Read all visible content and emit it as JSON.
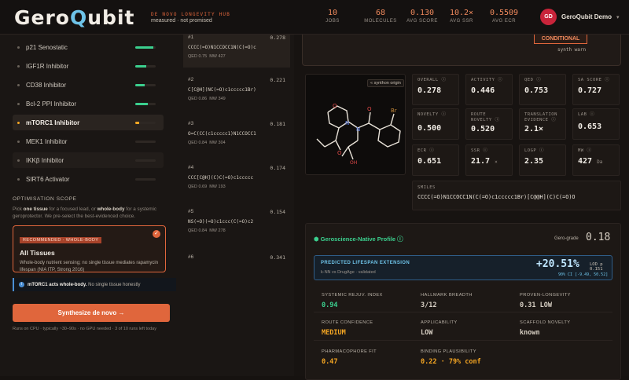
{
  "header": {
    "logo": "GeroQubit",
    "tagline_1": "DE NOVO LONGEVITY HUB",
    "tagline_2": "measured · not promised",
    "stats": [
      {
        "value": "10",
        "label": "JOBS"
      },
      {
        "value": "68",
        "label": "MOLECULES"
      },
      {
        "value": "0.130",
        "label": "AVG SCORE"
      },
      {
        "value": "10.2×",
        "label": "AVG SSR"
      },
      {
        "value": "0.5509",
        "label": "AVG ECR"
      }
    ],
    "user": {
      "initials": "GD",
      "name": "GeroQubit Demo",
      "chevron": "▾"
    }
  },
  "targets": [
    {
      "label": "p21 Senostatic",
      "progress": 0.9
    },
    {
      "label": "IGF1R Inhibitor",
      "progress": 0.55
    },
    {
      "label": "CD38 Inhibitor",
      "progress": 0.45
    },
    {
      "label": "Bcl-2 PPI Inhibitor",
      "progress": 0.6
    },
    {
      "label": "mTORC1 Inhibitor",
      "progress": 0.2
    },
    {
      "label": "MEK1 Inhibitor",
      "progress": 0.0
    },
    {
      "label": "IKKβ Inhibitor",
      "progress": 0.0
    },
    {
      "label": "SIRT6 Activator",
      "progress": 0.0
    }
  ],
  "scope": {
    "title": "OPTIMISATION SCOPE",
    "desc_1": "Pick ",
    "desc_b1": "one tissue",
    "desc_2": " for a focused lead, or ",
    "desc_b2": "whole-body",
    "desc_3": " for a systemic geroprotector. We pre-select the best-evidenced choice.",
    "card_badge": "RECOMMENDED · WHOLE-BODY",
    "card_title": "All Tissues",
    "card_body": "Whole-body nutrient sensing; no single tissue mediates rapamycin lifespan (NIA ITP, Strong 2016)",
    "note_bold": "mTORC1 acts whole-body.",
    "note_text": " No single tissue honestly",
    "button": "Synthesize de novo →",
    "runs": "Runs on CPU · typically ~30–90s · no GPU needed · 3 of 10 runs left today"
  },
  "molecules": [
    {
      "rank": "#1",
      "score": "0.278",
      "smiles": "CCCC(=O)N1CCOCC1N(C(=O)c",
      "qed": "QED 0.75",
      "mw": "MW 427"
    },
    {
      "rank": "#2",
      "score": "0.221",
      "smiles": "C[C@H](NC(=O)c1ccccc1Br)",
      "qed": "QED 0.86",
      "mw": "MW 349"
    },
    {
      "rank": "#3",
      "score": "0.181",
      "smiles": "O=C(CC(c1ccccc1)N1CCOCC1",
      "qed": "QED 0.84",
      "mw": "MW 304"
    },
    {
      "rank": "#4",
      "score": "0.174",
      "smiles": "CCC[C@H](C)C(=O)c1ccccc",
      "qed": "QED 0.69",
      "mw": "MW 193"
    },
    {
      "rank": "#5",
      "score": "0.154",
      "smiles": "NS(=O)(=O)c1ccc(C(=O)c2",
      "qed": "QED 0.84",
      "mw": "MW 278"
    },
    {
      "rank": "#6",
      "score": "0.341",
      "smiles": "",
      "qed": "",
      "mw": ""
    }
  ],
  "detail": {
    "condition": "CONDITIONAL",
    "synth_warn": "synth warn",
    "origin_button": "« synthon origin",
    "metrics": [
      {
        "k": "OVERALL ⓘ",
        "v": "0.278",
        "unit": ""
      },
      {
        "k": "ACTIVITY ⓘ",
        "v": "0.446",
        "unit": ""
      },
      {
        "k": "QED ⓘ",
        "v": "0.753",
        "unit": ""
      },
      {
        "k": "SA SCORE ⓘ",
        "v": "0.727",
        "unit": ""
      },
      {
        "k": "NOVELTY ⓘ",
        "v": "0.500",
        "unit": ""
      },
      {
        "k": "ROUTE NOVELTY ⓘ",
        "v": "0.520",
        "unit": ""
      },
      {
        "k": "TRANSLATION EVIDENCE ⓘ",
        "v": "2.1×",
        "unit": ""
      },
      {
        "k": "LAB ⓘ",
        "v": "0.653",
        "unit": ""
      },
      {
        "k": "ECR ⓘ",
        "v": "0.651",
        "unit": ""
      },
      {
        "k": "SSR ⓘ",
        "v": "21.7",
        "unit": "×"
      },
      {
        "k": "LOGP ⓘ",
        "v": "2.35",
        "unit": ""
      },
      {
        "k": "MW ⓘ",
        "v": "427",
        "unit": "Da"
      }
    ],
    "smiles_label": "SMILES",
    "smiles": "CCCC(=O)N1CCOCC1N(C(=O)c1ccccc1Br)[C@@H](C)C(=O)O"
  },
  "geroscience": {
    "title": "Geroscience-Native Profile ⓘ",
    "grade_label": "Gero-grade",
    "grade_value": "0.18",
    "lifespan_label": "PREDICTED LIFESPAN EXTENSION",
    "lifespan_sub": "k-NN vs DrugAge · validated",
    "lifespan_value": "+20.51%",
    "lod": "LOD p 0.151",
    "ci": "90% CI [-9.49, 50.52]",
    "cells": [
      {
        "k": "SYSTEMIC REJUV. INDEX",
        "v": "0.94",
        "color": "#3bcf8e"
      },
      {
        "k": "HALLMARK BREADTH",
        "v": "3/12",
        "color": "#d8d0c4"
      },
      {
        "k": "PROVEN-LONGEVITY",
        "v": "0.31 LOW",
        "color": "#d8d0c4"
      },
      {
        "k": "ROUTE CONFIDENCE",
        "v": "MEDIUM",
        "color": "#f5a623"
      },
      {
        "k": "APPLICABILITY",
        "v": "LOW",
        "color": "#d8d0c4"
      },
      {
        "k": "SCAFFOLD NOVELTY",
        "v": "known",
        "color": "#d8d0c4"
      },
      {
        "k": "PHARMACOPHORE FIT",
        "v": "0.47",
        "color": "#f5a623"
      },
      {
        "k": "BINDING PLAUSIBILITY",
        "v": "0.22 · 79% conf",
        "color": "#f5a623"
      }
    ]
  }
}
